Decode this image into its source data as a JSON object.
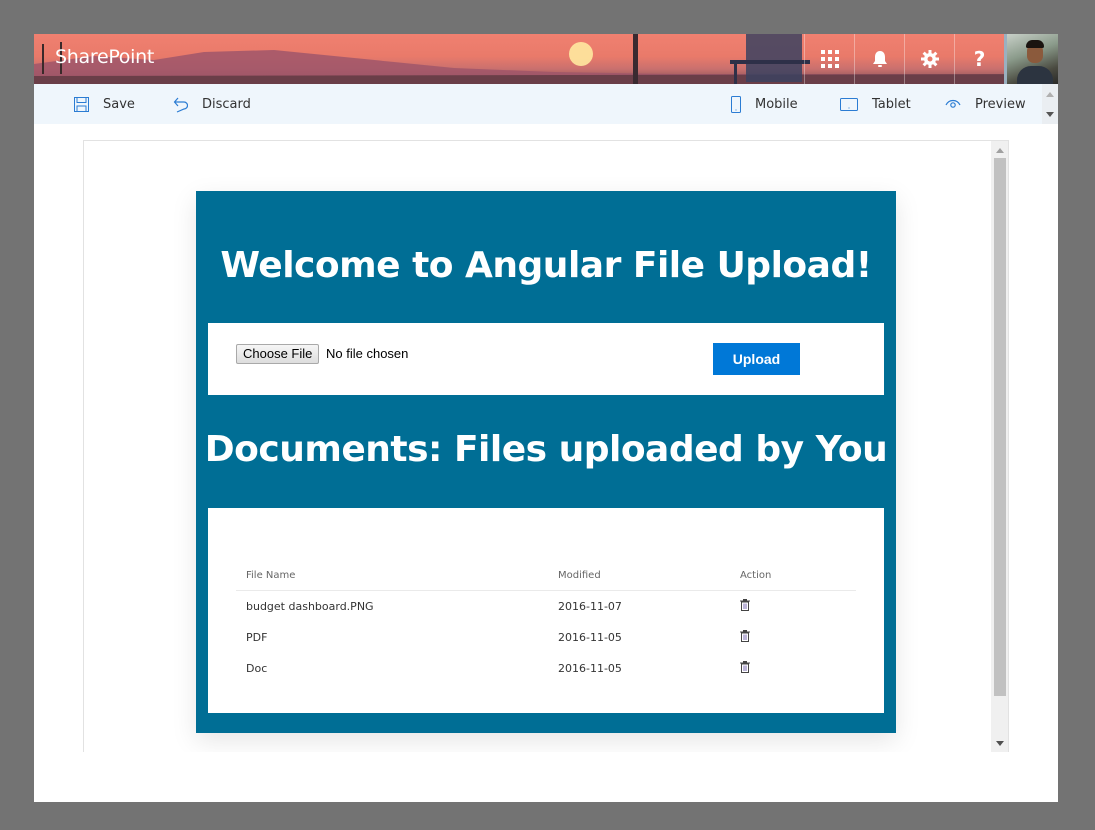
{
  "suitebar": {
    "brand": "SharePoint",
    "icons": [
      "app-launcher-icon",
      "bell-icon",
      "gear-icon",
      "help-icon"
    ],
    "help_glyph": "?",
    "avatar": "user-avatar"
  },
  "commandbar": {
    "save_label": "Save",
    "discard_label": "Discard",
    "mobile_label": "Mobile",
    "tablet_label": "Tablet",
    "preview_label": "Preview"
  },
  "app": {
    "title": "Welcome to Angular File Upload!",
    "choose_file_label": "Choose File",
    "no_file_text": "No file chosen",
    "upload_label": "Upload",
    "documents_title": "Documents: Files uploaded by You",
    "table": {
      "headers": [
        "File Name",
        "Modified",
        "Action"
      ],
      "rows": [
        {
          "name": "budget dashboard.PNG",
          "modified": "2016-11-07",
          "action": "delete-icon"
        },
        {
          "name": "PDF",
          "modified": "2016-11-05",
          "action": "delete-icon"
        },
        {
          "name": "Doc",
          "modified": "2016-11-05",
          "action": "delete-icon"
        }
      ]
    }
  },
  "colors": {
    "card_bg": "#006e95",
    "upload_button": "#0078d7",
    "command_bar_bg": "#eff6fc",
    "icon_accent": "#2b7cd3"
  }
}
